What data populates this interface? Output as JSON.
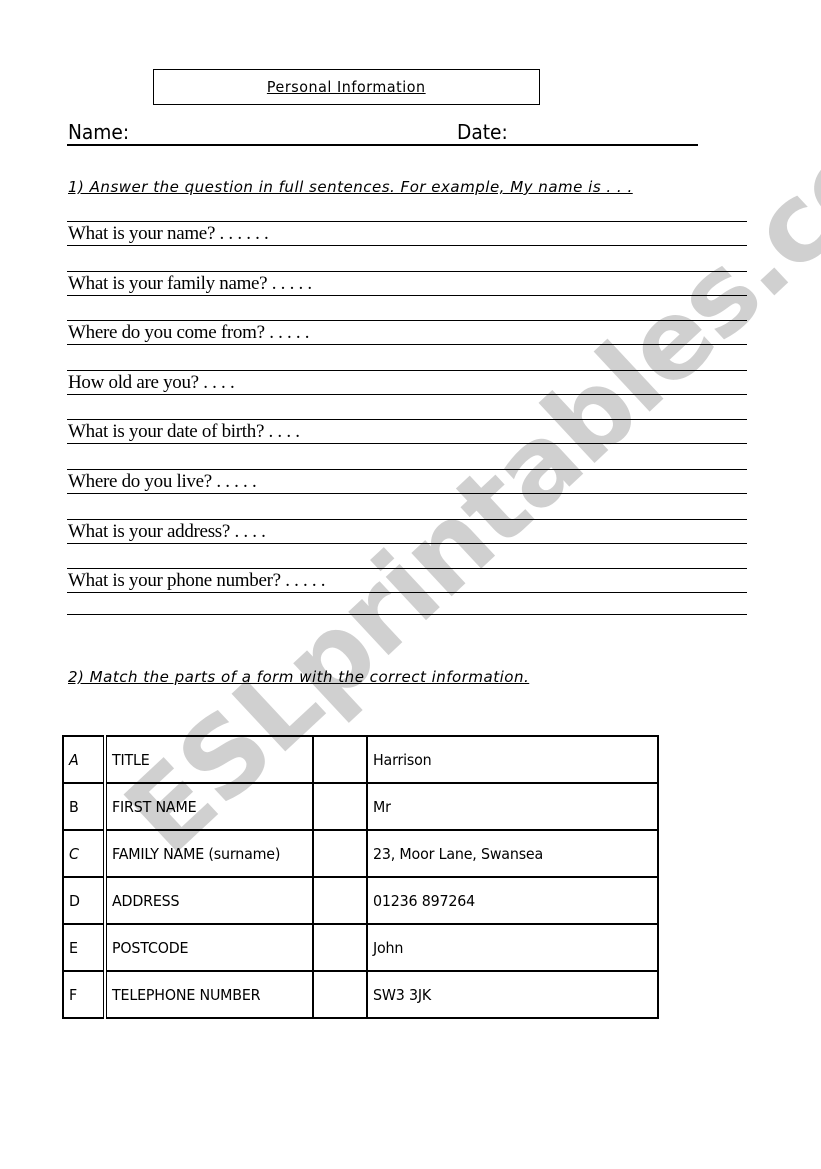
{
  "header": {
    "title": "Personal Information",
    "name_label": "Name:",
    "date_label": "Date:"
  },
  "section1": {
    "instruction": "1) Answer the question in full sentences. For example, My name is . . .",
    "questions": [
      "What is your name?  . . . . . .",
      "What is your family name? . . . . .",
      "Where do you come from? . . . . .",
      "How old are you? . . . .",
      "What is your date of birth? . . . .",
      "Where do you live? . . . . .",
      "What is your address? . . . .",
      "What is your phone number? . . . . ."
    ]
  },
  "section2": {
    "instruction": "2) Match the parts of a form with the correct information.",
    "rows": [
      {
        "letter": "A",
        "part": "TITLE",
        "blank": "",
        "info": "Harrison"
      },
      {
        "letter": "B",
        "part": "FIRST NAME",
        "blank": "",
        "info": "Mr"
      },
      {
        "letter": "C",
        "part": "FAMILY NAME (surname)",
        "blank": "",
        "info": "23, Moor Lane, Swansea"
      },
      {
        "letter": "D",
        "part": "ADDRESS",
        "blank": "",
        "info": "01236 897264"
      },
      {
        "letter": "E",
        "part": "POSTCODE",
        "blank": "",
        "info": "John"
      },
      {
        "letter": "F",
        "part": "TELEPHONE NUMBER",
        "blank": "",
        "info": "SW3 3JK"
      }
    ]
  },
  "watermark": {
    "text": "ESLprintables.com",
    "color": "#c8c8c8"
  }
}
